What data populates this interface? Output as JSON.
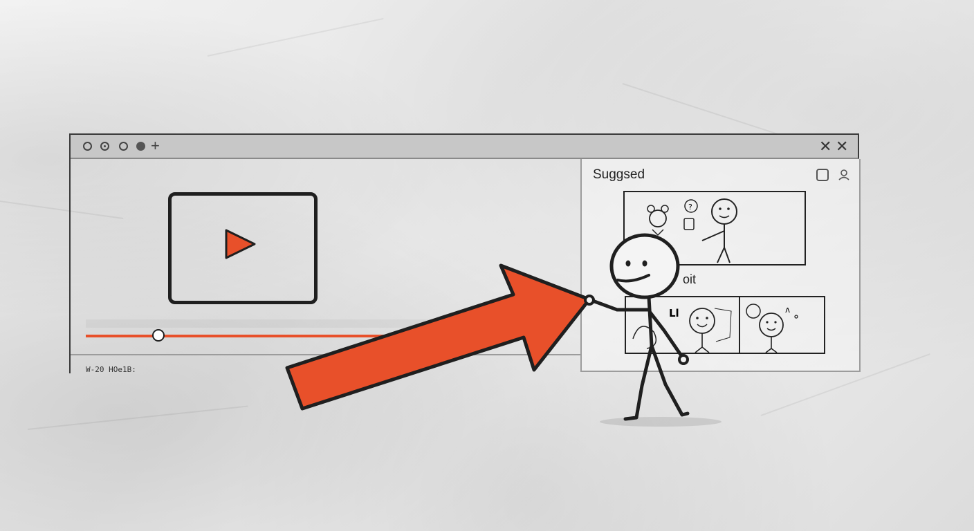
{
  "titlebar": {
    "icons": [
      "circle-icon",
      "radio-icon",
      "circle-icon",
      "dot-icon",
      "plus-icon"
    ],
    "close_labels": [
      "✕",
      "✕"
    ]
  },
  "player": {
    "time_text": "W-20 HOe1B:",
    "progress": 0.15,
    "accent_color": "#e8502a"
  },
  "sidebar": {
    "title": "Suggsed",
    "section_label": "oit",
    "icons": [
      "square-icon",
      "user-icon"
    ]
  },
  "illustration": {
    "arrow_color": "#e8502a",
    "figure": "stick-figure-pointing"
  }
}
